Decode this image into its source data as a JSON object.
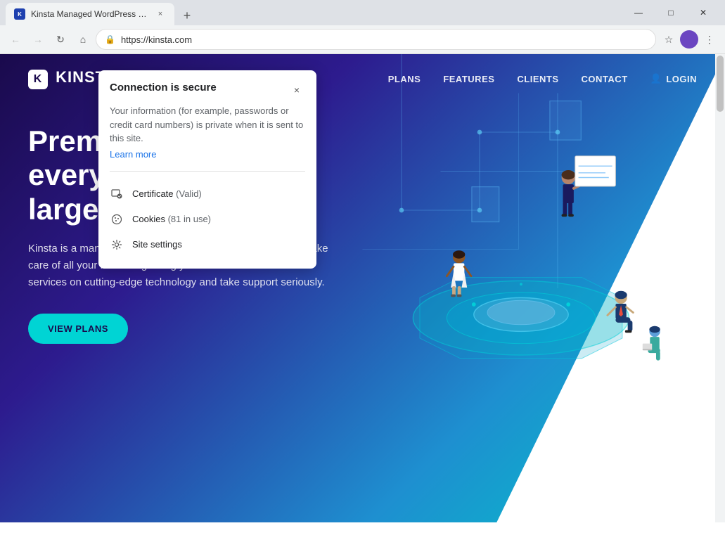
{
  "browser": {
    "tab": {
      "favicon": "K",
      "title": "Kinsta Managed WordPress Hos…",
      "close_label": "×"
    },
    "new_tab_label": "+",
    "nav": {
      "back_label": "←",
      "forward_label": "→",
      "refresh_label": "↻",
      "home_label": "⌂"
    },
    "address_bar": {
      "lock_icon": "🔒",
      "url": "https://kinsta.com"
    },
    "toolbar": {
      "star_label": "☆",
      "avatar_label": "",
      "menu_label": "⋮"
    },
    "window_controls": {
      "minimize": "—",
      "maximize": "□",
      "close": "✕"
    }
  },
  "security_popup": {
    "title": "Connection is secure",
    "description": "Your information (for example, passwords or credit card numbers) is private when it is sent to this site.",
    "learn_more": "Learn more",
    "close_label": "×",
    "items": [
      {
        "icon": "certificate",
        "label": "Certificate",
        "badge": "(Valid)"
      },
      {
        "icon": "cookies",
        "label": "Cookies",
        "badge": "(81 in use)"
      },
      {
        "icon": "settings",
        "label": "Site settings",
        "badge": ""
      }
    ]
  },
  "website": {
    "nav": {
      "logo": "KINSTA",
      "logo_k": "K",
      "links": [
        {
          "label": "PLANS"
        },
        {
          "label": "FEATURES"
        },
        {
          "label": "CLIENTS"
        },
        {
          "label": "CONTACT"
        }
      ],
      "login_icon": "👤",
      "login_label": "LOGIN"
    },
    "hero": {
      "title": "Premi hosting for everyone, small or large",
      "description": "Kinsta is a managed WordPress hosting provider that helps take care of all your needs regarding your website. We run our services on cutting-edge technology and take support seriously.",
      "cta_label": "VIEW PLANS"
    }
  }
}
